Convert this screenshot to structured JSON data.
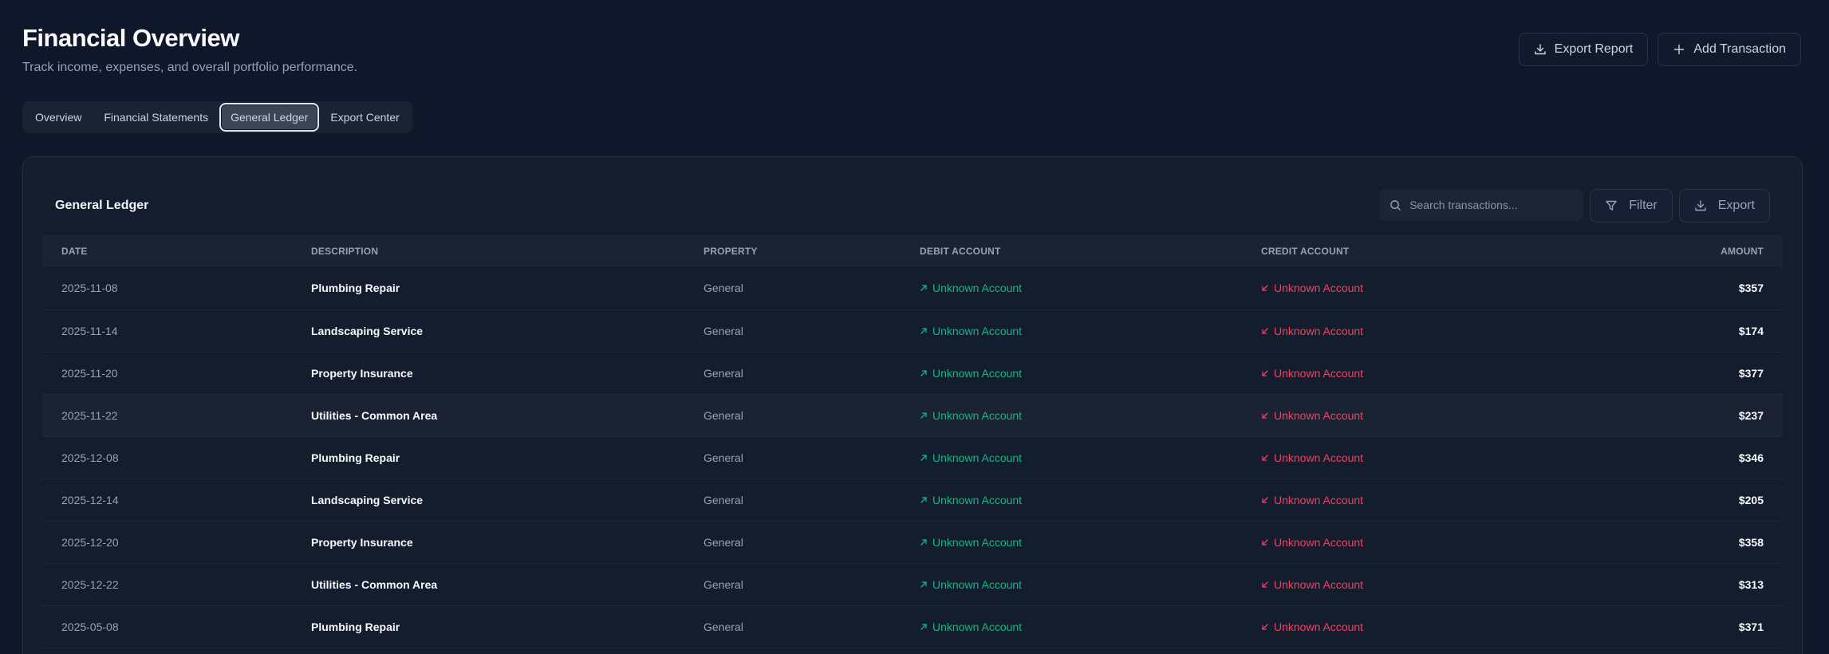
{
  "header": {
    "title": "Financial Overview",
    "subtitle": "Track income, expenses, and overall portfolio performance.",
    "export_report_label": "Export Report",
    "add_transaction_label": "Add Transaction"
  },
  "tabs": [
    {
      "label": "Overview",
      "active": false
    },
    {
      "label": "Financial Statements",
      "active": false
    },
    {
      "label": "General Ledger",
      "active": true
    },
    {
      "label": "Export Center",
      "active": false
    }
  ],
  "ledger": {
    "title": "General Ledger",
    "search_placeholder": "Search transactions...",
    "filter_label": "Filter",
    "export_label": "Export",
    "columns": [
      "Date",
      "Description",
      "Property",
      "Debit Account",
      "Credit Account",
      "Amount"
    ],
    "rows": [
      {
        "date": "2025-11-08",
        "description": "Plumbing Repair",
        "property": "General",
        "debit": "Unknown Account",
        "credit": "Unknown Account",
        "amount": "$357"
      },
      {
        "date": "2025-11-14",
        "description": "Landscaping Service",
        "property": "General",
        "debit": "Unknown Account",
        "credit": "Unknown Account",
        "amount": "$174"
      },
      {
        "date": "2025-11-20",
        "description": "Property Insurance",
        "property": "General",
        "debit": "Unknown Account",
        "credit": "Unknown Account",
        "amount": "$377"
      },
      {
        "date": "2025-11-22",
        "description": "Utilities - Common Area",
        "property": "General",
        "debit": "Unknown Account",
        "credit": "Unknown Account",
        "amount": "$237"
      },
      {
        "date": "2025-12-08",
        "description": "Plumbing Repair",
        "property": "General",
        "debit": "Unknown Account",
        "credit": "Unknown Account",
        "amount": "$346"
      },
      {
        "date": "2025-12-14",
        "description": "Landscaping Service",
        "property": "General",
        "debit": "Unknown Account",
        "credit": "Unknown Account",
        "amount": "$205"
      },
      {
        "date": "2025-12-20",
        "description": "Property Insurance",
        "property": "General",
        "debit": "Unknown Account",
        "credit": "Unknown Account",
        "amount": "$358"
      },
      {
        "date": "2025-12-22",
        "description": "Utilities - Common Area",
        "property": "General",
        "debit": "Unknown Account",
        "credit": "Unknown Account",
        "amount": "$313"
      },
      {
        "date": "2025-05-08",
        "description": "Plumbing Repair",
        "property": "General",
        "debit": "Unknown Account",
        "credit": "Unknown Account",
        "amount": "$371"
      }
    ]
  },
  "icons": {
    "export_report": "download-icon",
    "add_transaction": "plus-icon",
    "search": "search-icon",
    "filter": "filter-icon",
    "export": "download-icon",
    "debit": "arrow-up-right-icon",
    "credit": "arrow-down-left-icon"
  },
  "colors": {
    "background": "#0f172a",
    "debit": "#10b981",
    "credit": "#f43f5e"
  }
}
